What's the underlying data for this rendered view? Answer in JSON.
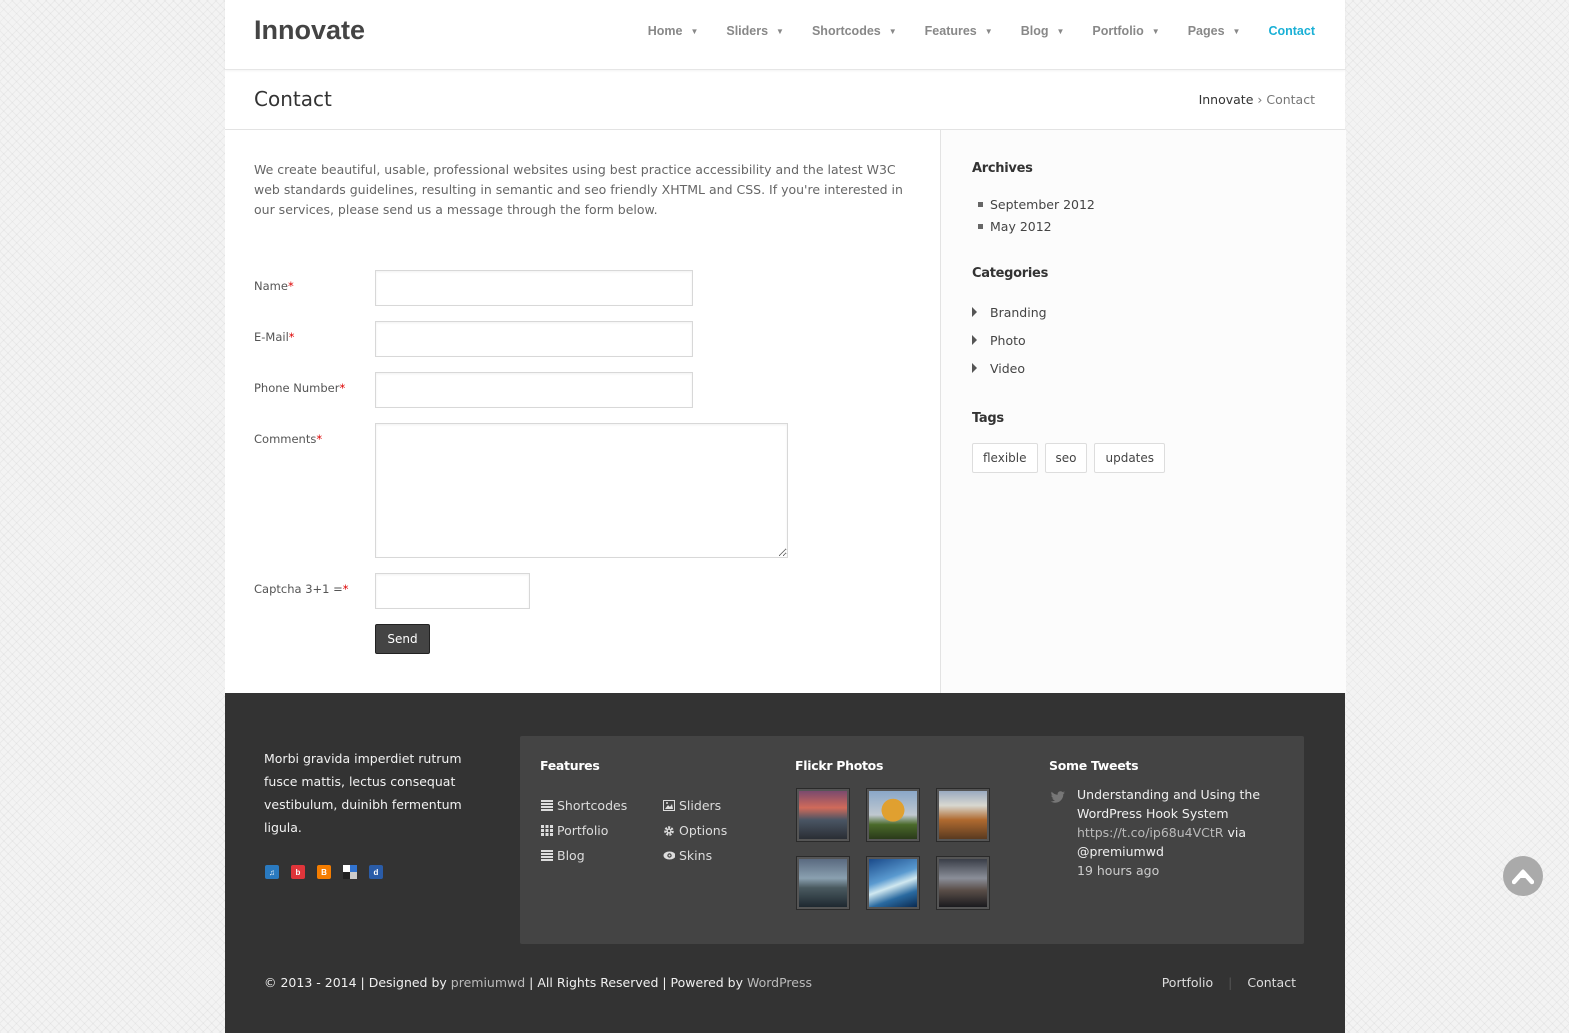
{
  "header": {
    "logo": "Innovate",
    "nav": [
      {
        "label": "Home",
        "has_menu": true
      },
      {
        "label": "Sliders",
        "has_menu": true
      },
      {
        "label": "Shortcodes",
        "has_menu": true
      },
      {
        "label": "Features",
        "has_menu": true
      },
      {
        "label": "Blog",
        "has_menu": true
      },
      {
        "label": "Portfolio",
        "has_menu": true
      },
      {
        "label": "Pages",
        "has_menu": true
      },
      {
        "label": "Contact",
        "has_menu": false,
        "active": true
      }
    ],
    "caret": "▼"
  },
  "titlebar": {
    "title": "Contact",
    "breadcrumb_home": "Innovate",
    "breadcrumb_sep": "›",
    "breadcrumb_current": "Contact"
  },
  "content": {
    "intro": "We create beautiful, usable, professional websites using best practice accessibility and the latest W3C web standards guidelines, resulting in semantic and seo friendly XHTML and CSS. If you're interested in our services, please send us a message through the form below.",
    "form": {
      "required_mark": "*",
      "name_label": "Name",
      "email_label": "E-Mail",
      "phone_label": "Phone Number",
      "comments_label": "Comments",
      "captcha_label": "Captcha 3+1 =",
      "name_value": "",
      "email_value": "",
      "phone_value": "",
      "comments_value": "",
      "captcha_value": "",
      "send_label": "Send"
    }
  },
  "sidebar": {
    "archives_title": "Archives",
    "archives": [
      "September 2012",
      "May 2012"
    ],
    "categories_title": "Categories",
    "categories": [
      "Branding",
      "Photo",
      "Video"
    ],
    "tags_title": "Tags",
    "tags": [
      "flexible",
      "seo",
      "updates"
    ]
  },
  "footer": {
    "text": "Morbi gravida imperdiet rutrum fusce mattis, lectus consequat vestibulum, duinibh fermentum ligula.",
    "social": [
      {
        "name": "lastfm-icon",
        "glyph": "♫",
        "color": "#2a7ac0"
      },
      {
        "name": "bebo-icon",
        "glyph": "b",
        "color": "#e0353a"
      },
      {
        "name": "blogger-icon",
        "glyph": "B",
        "color": "#f57d00"
      },
      {
        "name": "delicious-icon",
        "glyph": "",
        "color": "#444444"
      },
      {
        "name": "digg-icon",
        "glyph": "d",
        "color": "#2a5ca8"
      }
    ],
    "features_title": "Features",
    "features": [
      {
        "label": "Shortcodes",
        "icon": "list-icon"
      },
      {
        "label": "Sliders",
        "icon": "image-icon"
      },
      {
        "label": "Portfolio",
        "icon": "grid-icon"
      },
      {
        "label": "Options",
        "icon": "gear-icon"
      },
      {
        "label": "Blog",
        "icon": "list-icon"
      },
      {
        "label": "Skins",
        "icon": "eye-icon"
      }
    ],
    "flickr_title": "Flickr Photos",
    "tweets_title": "Some Tweets",
    "tweet_text": "Understanding and Using the WordPress Hook System ",
    "tweet_link": "https://t.co/ip68u4VCtR",
    "tweet_via": " via @premiumwd",
    "tweet_time": "19 hours ago",
    "copyright_prefix": "© 2013 - 2014 | Designed by ",
    "copyright_designer": "premiumwd",
    "copyright_middle": " | All Rights Reserved | Powered by ",
    "copyright_powered": "WordPress",
    "nav": [
      "Portfolio",
      "Contact"
    ],
    "nav_sep": "|"
  },
  "colors": {
    "accent": "#1ab0d6",
    "footer_bg": "#333333",
    "footer_box_bg": "#444444",
    "button_bg": "#444444",
    "required": "#dd0000"
  }
}
